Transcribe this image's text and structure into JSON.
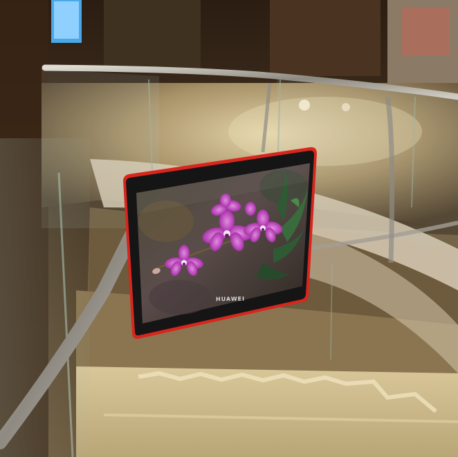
{
  "scene": {
    "description_free": true,
    "tablet": {
      "brand_text": "HUAWEI",
      "frame_color": "#d8261e",
      "bezel_color": "#151515"
    },
    "colors": {
      "wall_dark": "#3b2a1c",
      "marble": "#c9b690",
      "glass_edge": "#9fb2a4",
      "rail": "#b9b6ae",
      "orchid": "#b43fb4",
      "leaf": "#2f5a34"
    }
  }
}
